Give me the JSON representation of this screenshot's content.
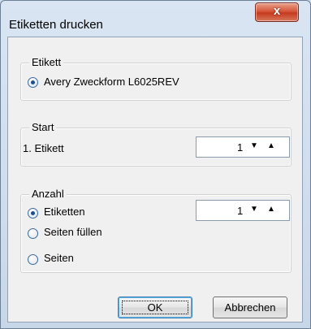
{
  "window": {
    "title": "Etiketten drucken",
    "close_glyph": "x"
  },
  "etikett_group": {
    "legend": "Etikett",
    "option_label": "Avery Zweckform L6025REV",
    "option_checked": true
  },
  "start_group": {
    "legend": "Start",
    "label": "1. Etikett",
    "value": "1",
    "down_glyph": "▼",
    "up_glyph": "▲"
  },
  "anzahl_group": {
    "legend": "Anzahl",
    "options": [
      {
        "label": "Etiketten",
        "checked": true
      },
      {
        "label": "Seiten füllen",
        "checked": false
      },
      {
        "label": "Seiten",
        "checked": false
      }
    ],
    "value": "1",
    "down_glyph": "▼",
    "up_glyph": "▲"
  },
  "buttons": {
    "ok_label": "OK",
    "cancel_label": "Abbrechen"
  },
  "colors": {
    "accent": "#1f4f87",
    "close_red": "#c63b1f"
  }
}
